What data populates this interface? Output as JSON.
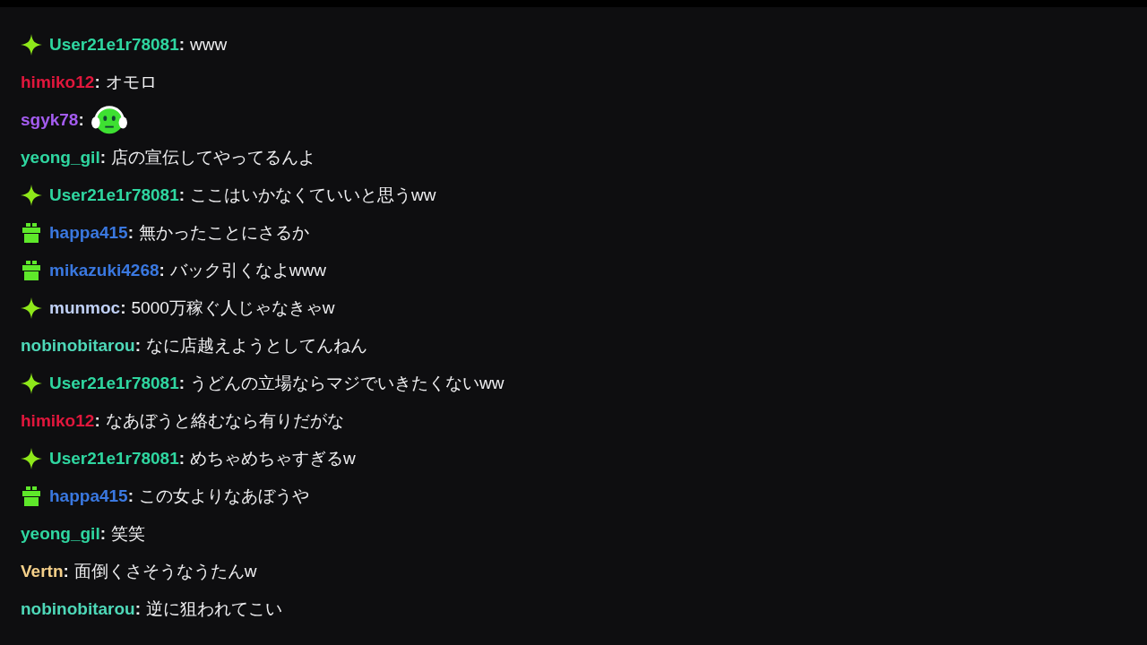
{
  "chat": [
    {
      "badge": {
        "kind": "sparkle"
      },
      "user": "User21e1r78081",
      "separator": ":",
      "color": "#2fd6a0",
      "message": {
        "kind": "text",
        "text": "www"
      }
    },
    {
      "user": "himiko12",
      "separator": ":",
      "color": "#e0173c",
      "message": {
        "kind": "text",
        "text": "オモロ"
      }
    },
    {
      "user": "sgyk78",
      "separator": ":",
      "color": "#a45cf0",
      "message": {
        "kind": "emote"
      }
    },
    {
      "user": "yeong_gil",
      "separator": ":",
      "color": "#2fd6a0",
      "message": {
        "kind": "text",
        "text": "店の宣伝してやってるんよ"
      }
    },
    {
      "badge": {
        "kind": "sparkle"
      },
      "user": "User21e1r78081",
      "separator": ":",
      "color": "#2fd6a0",
      "message": {
        "kind": "text",
        "text": "ここはいかなくていいと思うww"
      }
    },
    {
      "badge": {
        "kind": "gift"
      },
      "user": "happa415",
      "separator": ":",
      "color": "#3a78e0",
      "message": {
        "kind": "text",
        "text": "無かったことにさるか"
      }
    },
    {
      "badge": {
        "kind": "gift"
      },
      "user": "mikazuki4268",
      "separator": ":",
      "color": "#3a78e0",
      "message": {
        "kind": "text",
        "text": "バック引くなよwww"
      }
    },
    {
      "badge": {
        "kind": "sparkle"
      },
      "user": "munmoc",
      "separator": ":",
      "color": "#c0d0f5",
      "message": {
        "kind": "text",
        "text": "5000万稼ぐ人じゃなきゃw"
      }
    },
    {
      "user": "nobinobitarou",
      "separator": ":",
      "color": "#4ed8b8",
      "message": {
        "kind": "text",
        "text": "なに店越えようとしてんねん"
      }
    },
    {
      "badge": {
        "kind": "sparkle"
      },
      "user": "User21e1r78081",
      "separator": ":",
      "color": "#2fd6a0",
      "message": {
        "kind": "text",
        "text": "うどんの立場ならマジでいきたくないww"
      }
    },
    {
      "user": "himiko12",
      "separator": ":",
      "color": "#e0173c",
      "message": {
        "kind": "text",
        "text": "なあぼうと絡むなら有りだがな"
      }
    },
    {
      "badge": {
        "kind": "sparkle"
      },
      "user": "User21e1r78081",
      "separator": ":",
      "color": "#2fd6a0",
      "message": {
        "kind": "text",
        "text": "めちゃめちゃすぎるw"
      }
    },
    {
      "badge": {
        "kind": "gift"
      },
      "user": "happa415",
      "separator": ":",
      "color": "#3a78e0",
      "message": {
        "kind": "text",
        "text": "この女よりなあぼうや"
      }
    },
    {
      "user": "yeong_gil",
      "separator": ":",
      "color": "#2fd6a0",
      "message": {
        "kind": "text",
        "text": "笑笑"
      }
    },
    {
      "user": "Vertn",
      "separator": ":",
      "color": "#f5d08a",
      "message": {
        "kind": "text",
        "text": "面倒くさそうなうたんw"
      }
    },
    {
      "user": "nobinobitarou",
      "separator": ":",
      "color": "#4ed8b8",
      "message": {
        "kind": "text",
        "text": "逆に狙われてこい"
      }
    }
  ]
}
